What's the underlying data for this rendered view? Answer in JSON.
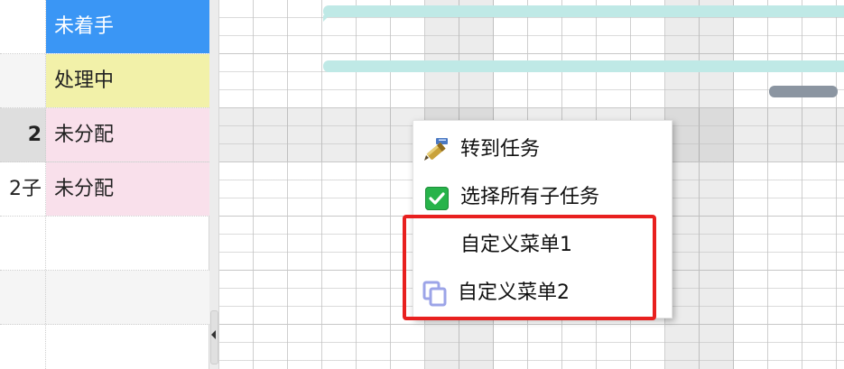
{
  "rows": [
    {
      "name": "",
      "status": "未着手",
      "status_kind": "notstarted"
    },
    {
      "name": "",
      "status": "处理中",
      "status_kind": "processing"
    },
    {
      "name": "2",
      "status": "未分配",
      "status_kind": "unassigned"
    },
    {
      "name": "2子",
      "status": "未分配",
      "status_kind": "unassigned"
    },
    {
      "name": "",
      "status": ""
    },
    {
      "name": "",
      "status": ""
    },
    {
      "name": "",
      "status": ""
    }
  ],
  "context_menu": {
    "items": [
      {
        "label": "转到任务",
        "icon": "pen-icon"
      },
      {
        "label": "选择所有子任务",
        "icon": "checkbox-icon"
      },
      {
        "label": "自定义菜单1",
        "icon": ""
      },
      {
        "label": "自定义菜单2",
        "icon": "copy-icon"
      }
    ]
  },
  "colors": {
    "status_notstarted": "#3a96f5",
    "status_processing": "#f2f1a9",
    "status_unassigned": "#f9e0eb",
    "bar_teal": "#bfe9e6",
    "bar_gray": "#8b95a1",
    "annotation_red": "#e8201f"
  }
}
